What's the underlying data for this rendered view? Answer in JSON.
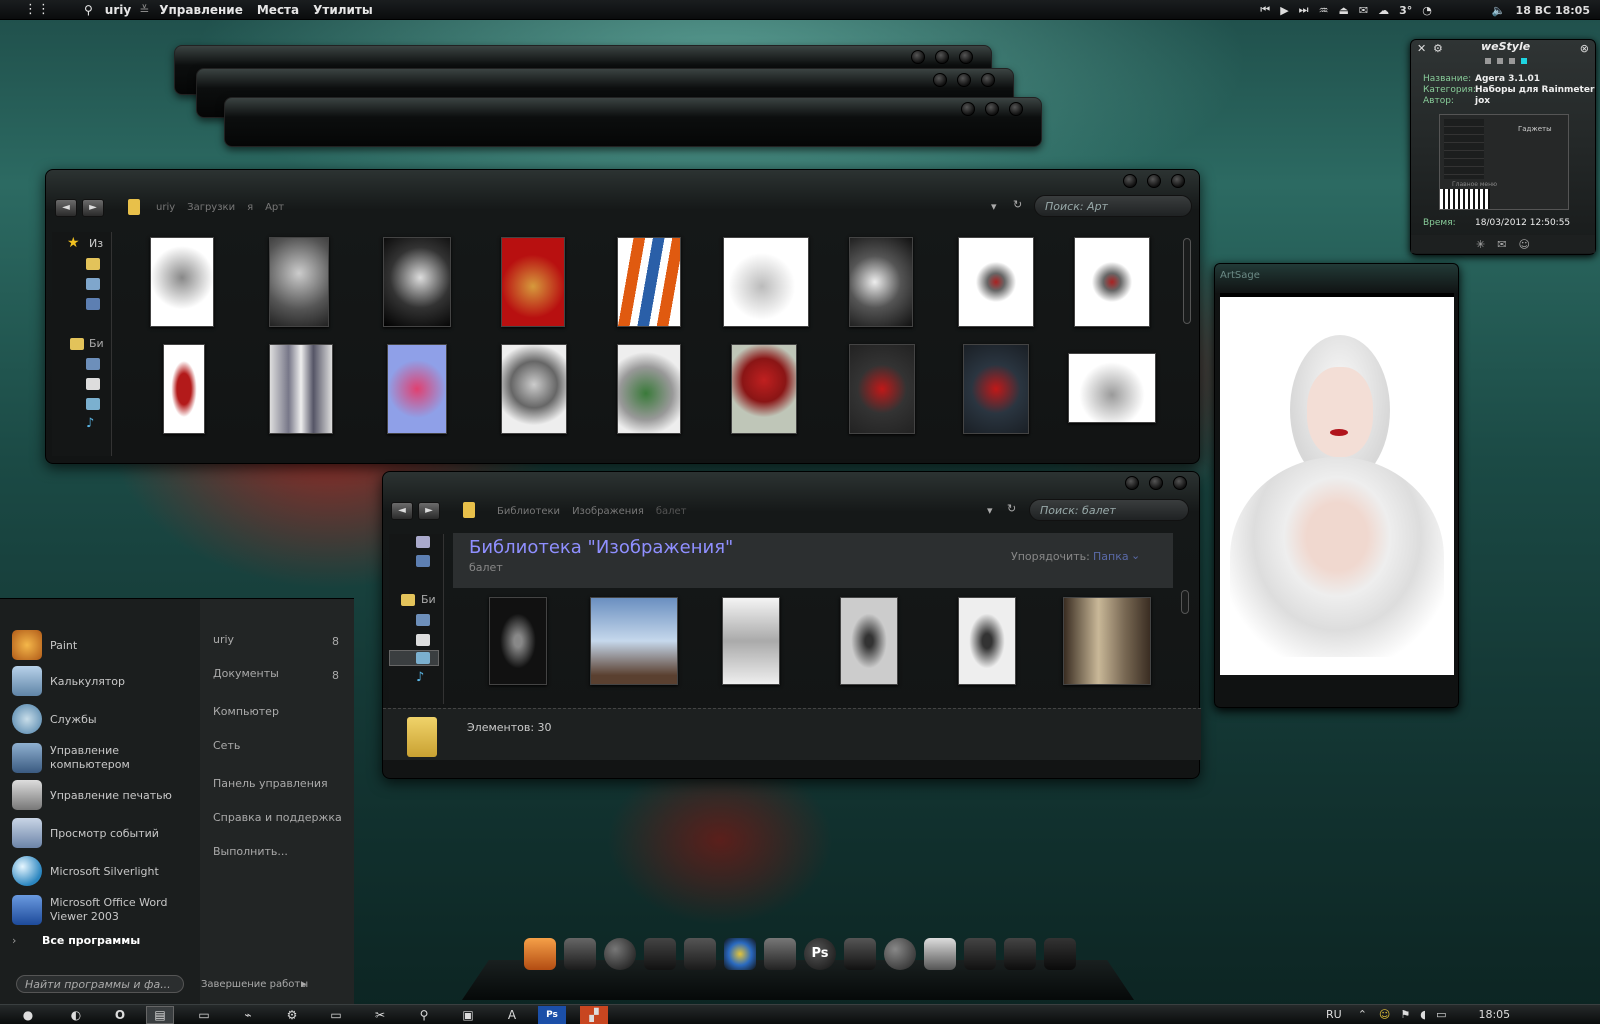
{
  "topbar": {
    "user": "uriy",
    "menus": [
      "Управление",
      "Места",
      "Утилиты"
    ],
    "weather_temp": "3°",
    "datetime": "18 ВС  18:05"
  },
  "explorer_art": {
    "breadcrumb": [
      "uriy",
      "Загрузки",
      "я",
      "Арт"
    ],
    "search_placeholder": "Поиск: Арт",
    "sidebar_label_fav": "Из",
    "sidebar_label_lib": "Би"
  },
  "explorer_ballet": {
    "breadcrumb": [
      "Библиотеки",
      "Изображения",
      "балет"
    ],
    "search_placeholder": "Поиск: балет",
    "library_title": "Библиотека \"Изображения\"",
    "library_subtitle": "балет",
    "arrange_label": "Упорядочить:",
    "arrange_value": "Папка",
    "sidebar_label_lib": "Би",
    "item_count": "Элементов: 30"
  },
  "start_menu": {
    "programs": [
      {
        "label": "Paint",
        "icon": "paint-icon",
        "color": "#d98c2b"
      },
      {
        "label": "Калькулятор",
        "icon": "calculator-icon",
        "color": "#6a8fb0"
      },
      {
        "label": "Службы",
        "icon": "services-gear-icon",
        "color": "#6b9ec0"
      },
      {
        "label": "Управление компьютером",
        "icon": "computer-management-icon",
        "color": "#7a8fa8"
      },
      {
        "label": "Управление печатью",
        "icon": "printer-icon",
        "color": "#b0b0b0"
      },
      {
        "label": "Просмотр событий",
        "icon": "event-viewer-icon",
        "color": "#8ca0c0"
      },
      {
        "label": "Microsoft Silverlight",
        "icon": "silverlight-icon",
        "color": "#4aa6d8"
      },
      {
        "label": "Microsoft Office Word Viewer 2003",
        "icon": "word-icon",
        "color": "#3b6fc0"
      }
    ],
    "all_programs": "Все программы",
    "search_placeholder": "Найти программы и фа...",
    "shutdown": "Завершение работы",
    "places": [
      {
        "label": "uriy",
        "count": "8"
      },
      {
        "label": "Документы",
        "count": "8"
      },
      {
        "label": "Компьютер",
        "count": ""
      },
      {
        "label": "Сеть",
        "count": ""
      },
      {
        "label": "Панель управления",
        "count": ""
      },
      {
        "label": "Справка и поддержка",
        "count": ""
      },
      {
        "label": "Выполнить...",
        "count": ""
      }
    ]
  },
  "westyle": {
    "title": "weStyle",
    "name_key": "Название:",
    "name_val": "Agera 3.1.01",
    "category_key": "Категория:",
    "category_val": "Наборы для Rainmeter",
    "author_key": "Автор:",
    "author_val": "jox",
    "time_key": "Время:",
    "time_val": "18/03/2012 12:50:55",
    "preview_label_right": "Гаджеты",
    "preview_label_bottom": "Главное меню"
  },
  "artsage": {
    "title": "ArtSage"
  },
  "taskbar": {
    "lang": "RU",
    "clock": "18:05"
  },
  "colors": {
    "accent_link": "#8f8fff",
    "arrange_value": "#5a6aa8"
  }
}
